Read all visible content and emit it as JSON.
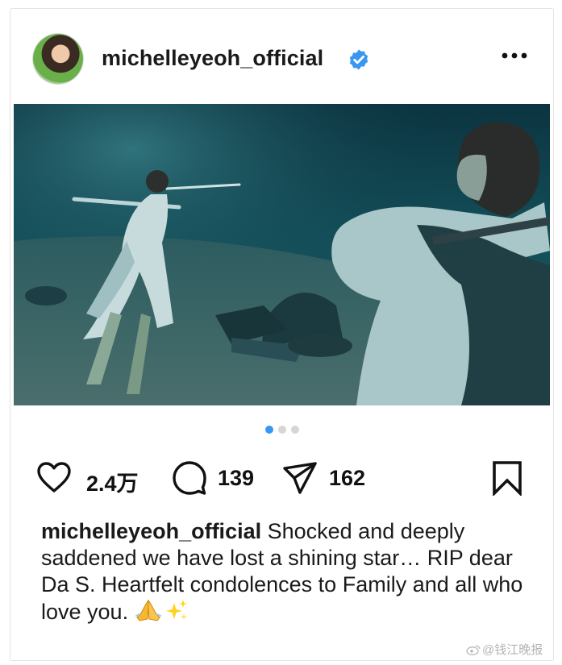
{
  "post": {
    "username": "michelleyeoh_official",
    "verified": true,
    "more_menu_icon": "more-horizontal-icon",
    "media": {
      "carousel_total": 3,
      "carousel_active_index": 0
    },
    "actions": {
      "likes": "2.4万",
      "comments": "139",
      "shares": "162"
    },
    "caption": {
      "username": "michelleyeoh_official",
      "text": " Shocked and deeply saddened we have lost a shining star… RIP dear Da S. Heartfelt condolences to Family and all who love you. ",
      "emojis": [
        "folded-hands-emoji",
        "sparkles-emoji"
      ]
    }
  },
  "watermark": {
    "text": "@钱江晚报"
  },
  "colors": {
    "accent_blue": "#3897f0",
    "verified_blue": "#3897f0",
    "text": "#1a1a1a"
  }
}
